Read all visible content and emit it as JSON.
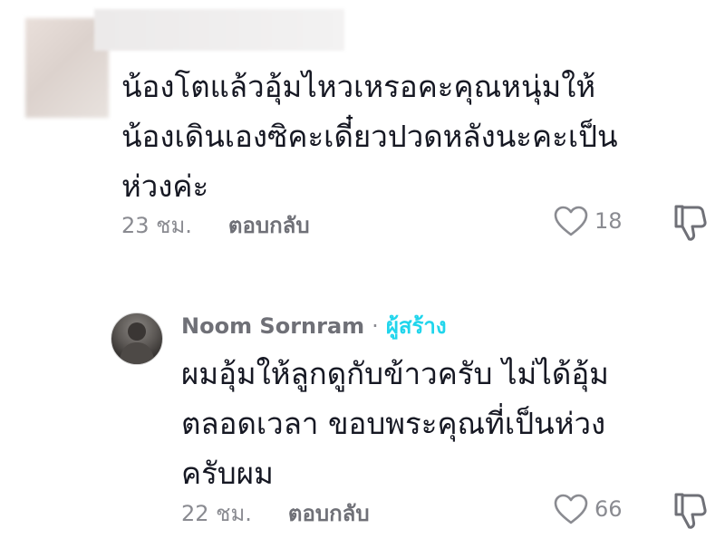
{
  "comment": {
    "text": "น้องโตแล้วอุ้มไหวเหรอคะคุณหนุ่มให้\nน้องเดินเองซิคะเดี๋ยวปวดหลังนะคะเป็น\nห่วงค่ะ",
    "time": "23 ชม.",
    "reply_label": "ตอบกลับ",
    "likes": "18"
  },
  "reply": {
    "author": "Noom Sornram",
    "separator": "·",
    "creator_badge": "ผู้สร้าง",
    "text": "ผมอุ้มให้ลูกดูกับข้าวครับ ไม่ได้อุ้ม\nตลอดเวลา ขอบพระคุณที่เป็นห่วง\nครับผม",
    "time": "22 ชม.",
    "reply_label": "ตอบกลับ",
    "likes": "66"
  },
  "colors": {
    "text": "#161823",
    "muted": "#8a8b91",
    "creator": "#20d5ec"
  },
  "icons": {
    "like": "heart-outline-icon",
    "dislike": "thumbs-down-icon"
  }
}
